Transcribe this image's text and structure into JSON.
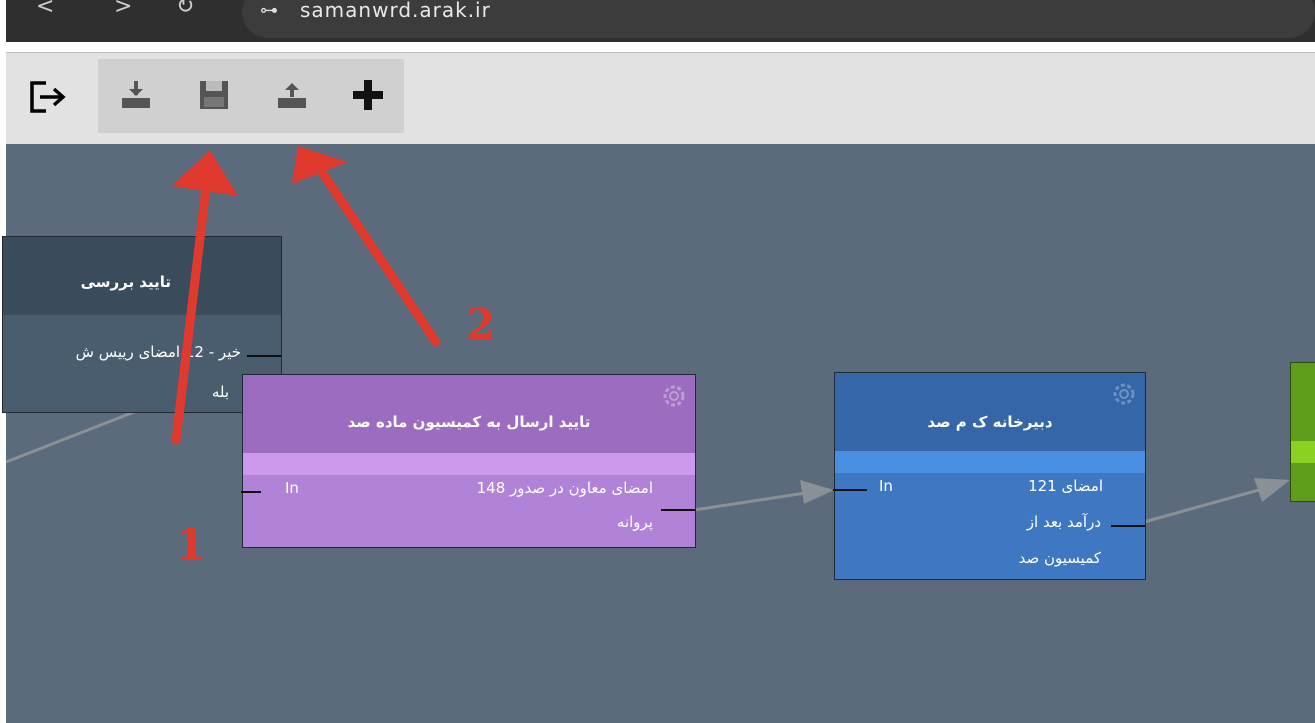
{
  "browser": {
    "back": "<",
    "forward": ">",
    "reload": "↻",
    "site_icon": "⊶",
    "url": "samanwrd.arak.ir"
  },
  "toolbar": {
    "exit_icon": "exit-icon",
    "buttons": [
      "import-icon",
      "save-icon",
      "export-icon",
      "add-icon"
    ]
  },
  "nodes": {
    "dark": {
      "title": "تایید بررسی",
      "row1": "خیر - 12 امضای رییس ش",
      "row2": "بله"
    },
    "purple": {
      "title": "تایید ارسال به کمیسیون ماده صد",
      "in": "In",
      "row1": "امضای معاون در صدور 148",
      "row2": "پروانه"
    },
    "blue": {
      "title": "دبیرخانه ک م صد",
      "in": "In",
      "row1": "امضای 121",
      "row2": "درآمد بعد از",
      "row3": "کمیسیون صد"
    }
  },
  "annotations": {
    "label1": "1",
    "label2": "2"
  },
  "colors": {
    "canvas": "#5b6b7b",
    "purple_node": "#9a6ec0",
    "blue_node": "#3a70b8",
    "green_node": "#5f9e1a",
    "annotation_red": "#e03a2f"
  }
}
